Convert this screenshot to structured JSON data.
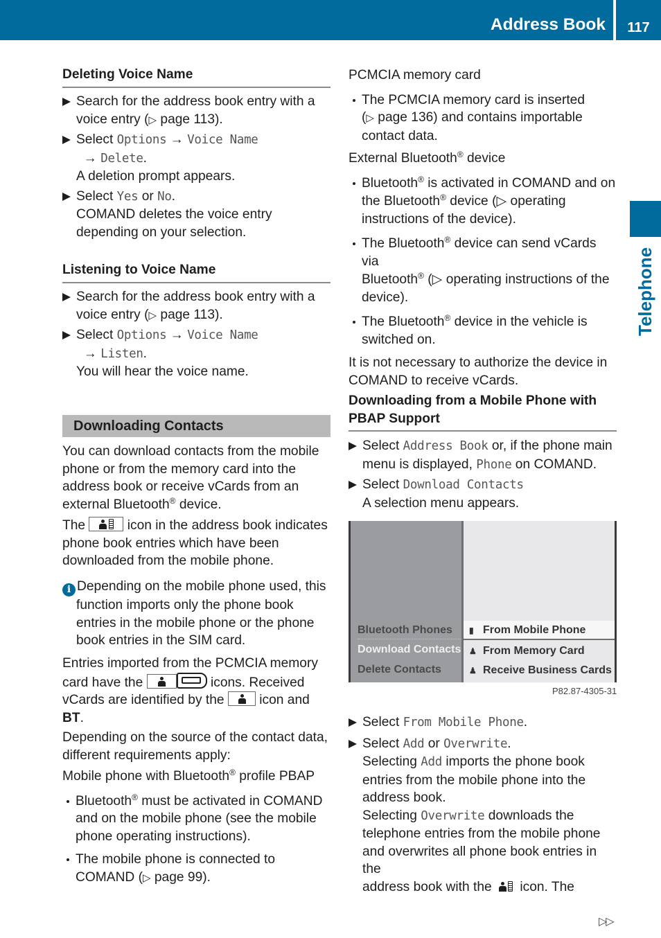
{
  "header": {
    "title": "Address Book",
    "page_number": "117",
    "color": "#006b9c"
  },
  "side_tab": {
    "label": "Telephone"
  },
  "left": {
    "deleting": {
      "heading": "Deleting Voice Name",
      "step1_a": "Search for the address book entry with a",
      "step1_b": "voice entry (",
      "ref_arrow": "▷",
      "step1_page": " page 113).",
      "step2_select": "Select ",
      "step2_options": "Options",
      "arrow": " → ",
      "step2_voice_name": "Voice Name",
      "step2_arrow2": " → ",
      "step2_delete": "Delete",
      "step2_period": ".",
      "step2_result": "A deletion prompt appears.",
      "step3_select": "Select ",
      "step3_yes": "Yes",
      "step3_or": " or ",
      "step3_no": "No",
      "step3_period": ".",
      "step3_result_a": "COMAND deletes the voice entry",
      "step3_result_b": "depending on your selection."
    },
    "listening": {
      "heading": "Listening to Voice Name",
      "step1_a": "Search for the address book entry with a",
      "step1_b": "voice entry (",
      "step1_page": " page 113).",
      "step2_select": "Select ",
      "step2_options": "Options",
      "step2_voice_name": "Voice Name",
      "step2_listen": "Listen",
      "step2_result": "You will hear the voice name."
    },
    "downloading": {
      "heading": "Downloading Contacts",
      "intro_1": "You can download contacts from the mobile",
      "intro_2": "phone or from the memory card into the",
      "intro_3": "address book or receive vCards from an",
      "intro_4a": "external Bluetooth",
      "reg": "®",
      "intro_4b": " device.",
      "icon_1a": "The",
      "icon_1b": "icon in the address book indicates",
      "icon_2": "phone book entries which have been",
      "icon_3": "downloaded from the mobile phone.",
      "info_1": "Depending on the mobile phone used, this",
      "info_2": "function imports only the phone book",
      "info_3": "entries in the mobile phone or the phone",
      "info_4": "book entries in the SIM card.",
      "pcmcia_1": "Entries imported from the PCMCIA memory",
      "pcmcia_2a": "card have the",
      "pcmcia_2b": "icons. Received",
      "pcmcia_3a": "vCards are identified by the",
      "pcmcia_3b": "icon and",
      "pcmcia_4_bold": "BT",
      "pcmcia_4_end": ".",
      "source_1": "Depending on the source of the contact data,",
      "source_2": "different requirements apply:",
      "pbap_a": "Mobile phone with Bluetooth",
      "pbap_b": " profile PBAP",
      "b1_a": "Bluetooth",
      "b1_b": " must be activated in COMAND",
      "b1_c": "and on the mobile phone (see the mobile",
      "b1_d": "phone operating instructions).",
      "b2_a": "The mobile phone is connected to",
      "b2_b": "COMAND (",
      "b2_page": " page 99)."
    }
  },
  "right": {
    "pcmcia_title": "PCMCIA memory card",
    "pc_b1_a": "The PCMCIA memory card is inserted",
    "pc_b1_b_page": " page 136) and contains importable",
    "pc_b1_c": "contact data.",
    "ext_a": "External Bluetooth",
    "ext_b": " device",
    "eb1_a": "Bluetooth",
    "eb1_b": " is activated in COMAND and on",
    "eb1_c": "the Bluetooth",
    "eb1_d": " device (",
    "eb1_e": " operating",
    "eb1_f": "instructions of the device).",
    "eb2_a": "The Bluetooth",
    "eb2_b": " device can send vCards via",
    "eb2_c": "Bluetooth",
    "eb2_d": " (",
    "eb2_e": " operating instructions of the",
    "eb2_f": "device).",
    "eb3_a": "The Bluetooth",
    "eb3_b": " device in the vehicle is",
    "eb3_c": "switched on.",
    "auth_1": "It is not necessary to authorize the device in",
    "auth_2": "COMAND to receive vCards.",
    "pbap_heading_1": "Downloading from a Mobile Phone with",
    "pbap_heading_2": "PBAP Support",
    "s1_select": "Select ",
    "s1_ab": "Address Book",
    "s1_rest": " or, if the phone main",
    "s1_b": "menu is displayed, ",
    "s1_phone": "Phone",
    "s1_c": " on COMAND.",
    "s2_select": "Select ",
    "s2_dc": "Download Contacts",
    "s2_result": "A selection menu appears.",
    "s3_select": "Select ",
    "s3_fmp": "From Mobile Phone",
    "s3_period": ".",
    "s4_select": "Select ",
    "s4_add": "Add",
    "s4_or": " or ",
    "s4_overwrite": "Overwrite",
    "s4_period": ".",
    "s4_r1a": "Selecting ",
    "s4_r1_add": "Add",
    "s4_r1b": " imports the phone book",
    "s4_r2": "entries from the mobile phone into the",
    "s4_r3": "address book.",
    "s4_r4a": "Selecting ",
    "s4_r4_ow": "Overwrite",
    "s4_r4b": " downloads the",
    "s4_r5": "telephone entries from the mobile phone",
    "s4_r6": "and overwrites all phone book entries in the",
    "s4_r7a": "address book with the",
    "s4_r7b": " icon. The"
  },
  "screen": {
    "menu": [
      {
        "label": "Bluetooth Phones",
        "selected": false
      },
      {
        "label": "Download Contacts",
        "selected": true
      },
      {
        "label": "Delete Contacts",
        "selected": false
      }
    ],
    "submenu": [
      {
        "icon": "mobile-phone-icon",
        "label": "From Mobile Phone",
        "selected": true
      },
      {
        "icon": "memory-card-contact-icon",
        "label": "From Memory Card",
        "selected": false
      },
      {
        "icon": "bluetooth-contact-icon",
        "label": "Receive Business Cards",
        "selected": false
      }
    ],
    "figure_code": "P82.87-4305-31"
  },
  "footer": {
    "continue_marker": "▷▷"
  }
}
